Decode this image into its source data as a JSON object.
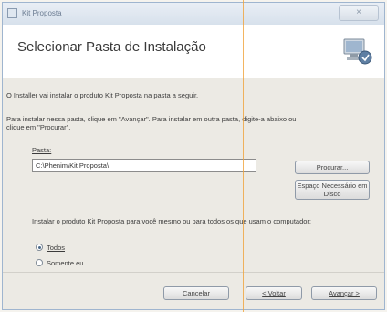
{
  "window": {
    "title": "Kit Proposta",
    "close_symbol": "×"
  },
  "header": {
    "heading": "Selecionar Pasta de Instalação",
    "icon": "computer-install-icon"
  },
  "body": {
    "intro": "O Installer vai instalar o produto Kit Proposta na pasta a seguir.",
    "instruction_line1": "Para instalar nessa pasta, clique em \"Avançar\". Para instalar em outra pasta, digite-a abaixo ou",
    "instruction_line2": "clique em \"Procurar\".",
    "folder_label": "Pasta:",
    "folder_value": "C:\\Phenim\\Kit Proposta\\",
    "browse_button": "Procurar...",
    "space_button_line1": "Espaço Necessário em",
    "space_button_line2": "Disco",
    "install_for_text": "Instalar o produto Kit Proposta para você mesmo ou para todos os que usam o computador:",
    "radio_all": "Todos",
    "radio_only_me": "Somente eu"
  },
  "footer": {
    "cancel": "Cancelar",
    "back": "< Voltar",
    "next": "Avançar >"
  }
}
